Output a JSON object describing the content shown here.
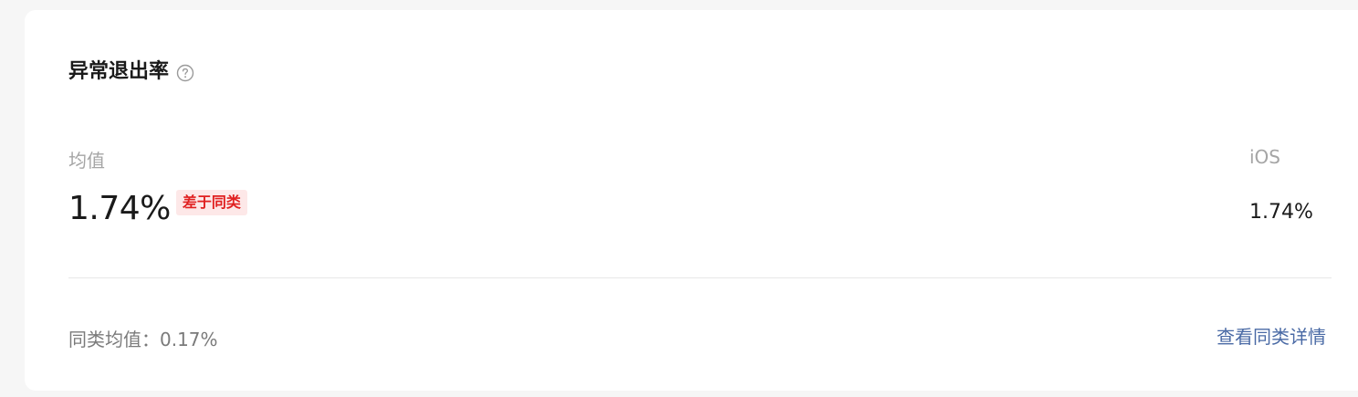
{
  "header": {
    "title": "异常退出率",
    "help_icon": "question-circle-icon"
  },
  "stats": {
    "average_label": "均值",
    "average_value": "1.74%",
    "comparison_badge": "差于同类",
    "platform_label": "iOS",
    "platform_value": "1.74%"
  },
  "footer": {
    "peer_average": "同类均值：0.17%",
    "details_link": "查看同类详情"
  },
  "colors": {
    "badge_bg": "#fde8e8",
    "badge_text": "#e02020",
    "link": "#4a6aa5",
    "muted_text": "#a5a5a5"
  }
}
